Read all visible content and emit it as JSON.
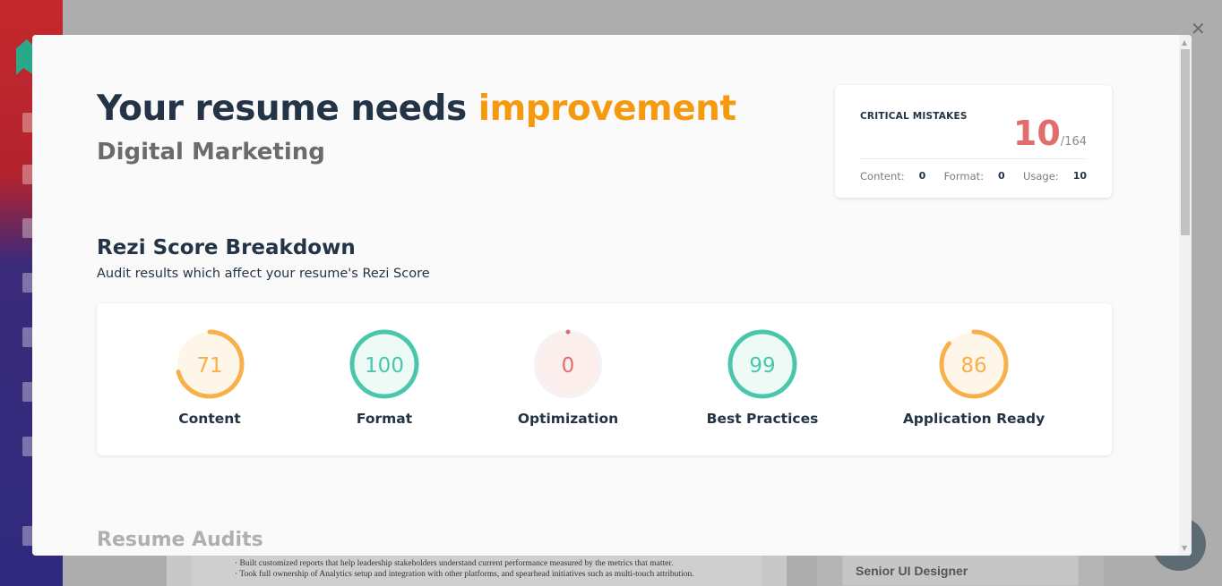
{
  "background": {
    "doc_lines": [
      "· Built customized reports that help leadership stakeholders understand current performance measured by the metrics that matter.",
      "· Took full ownership of Analytics setup and integration with other platforms, and spearhead initiatives such as multi-touch attribution."
    ],
    "right_card_title": "Senior UI Designer"
  },
  "close_icon": "✕",
  "modal": {
    "headline_prefix": "Your resume needs ",
    "headline_accent": "improvement",
    "subtitle": "Digital Marketing",
    "critical": {
      "title": "CRITICAL MISTAKES",
      "count": "10",
      "total": "/164",
      "breakdown": [
        {
          "label": "Content:",
          "value": "0"
        },
        {
          "label": "Format:",
          "value": "0"
        },
        {
          "label": "Usage:",
          "value": "10"
        }
      ]
    },
    "breakdown_title": "Rezi Score Breakdown",
    "breakdown_subtitle": "Audit results which affect your resume's Rezi Score",
    "scores": [
      {
        "label": "Content",
        "value": 71,
        "color": "#f7b04a",
        "fill": "#fff6ea"
      },
      {
        "label": "Format",
        "value": 100,
        "color": "#4ac7ab",
        "fill": "#eefaf6"
      },
      {
        "label": "Optimization",
        "value": 0,
        "color": "#e16d6d",
        "fill": "#fdeeee"
      },
      {
        "label": "Best Practices",
        "value": 99,
        "color": "#4ac7ab",
        "fill": "#eefaf6"
      },
      {
        "label": "Application Ready",
        "value": 86,
        "color": "#f7b04a",
        "fill": "#fff6ea"
      }
    ],
    "audits_title": "Resume Audits"
  },
  "colors": {
    "accent_orange": "#f59a0e",
    "critical_red": "#e16d6d",
    "navy": "#243447"
  }
}
